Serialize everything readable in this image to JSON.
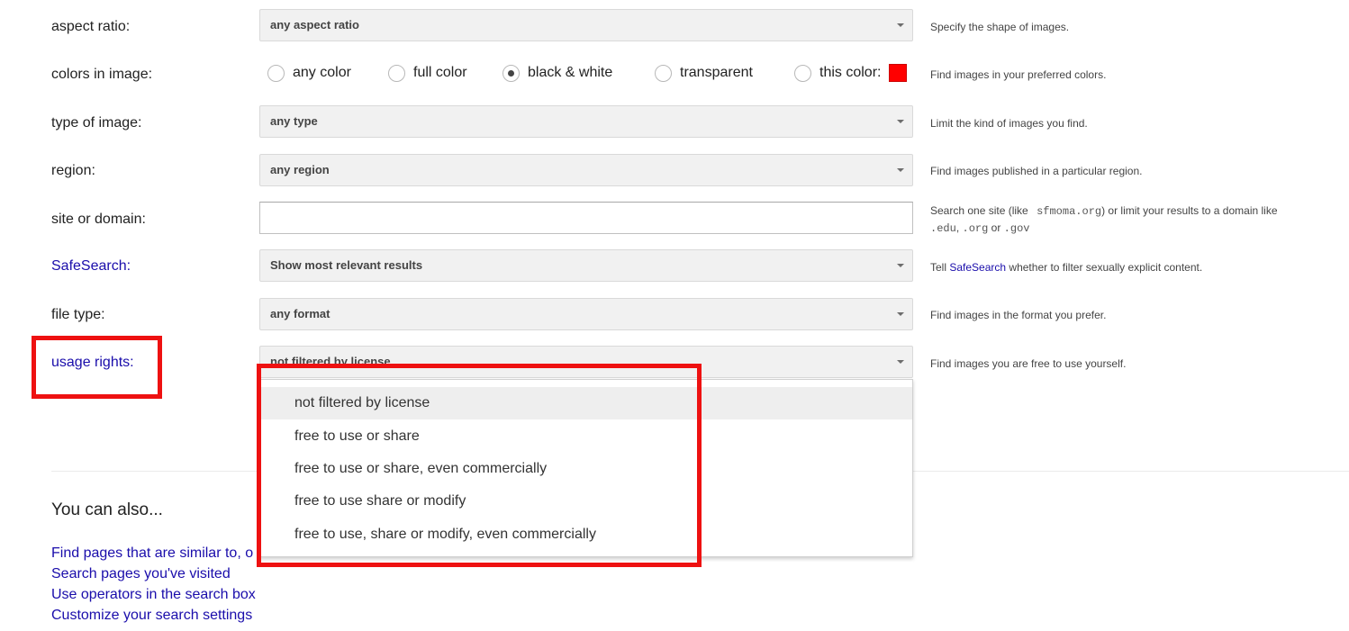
{
  "rows": {
    "aspect_ratio": {
      "label": "aspect ratio:",
      "value": "any aspect ratio",
      "hint": "Specify the shape of images."
    },
    "colors": {
      "label": "colors in image:",
      "options": [
        "any color",
        "full color",
        "black & white",
        "transparent",
        "this color:"
      ],
      "selected": "black & white",
      "swatch_color": "#ff0000",
      "hint": "Find images in your preferred colors."
    },
    "type": {
      "label": "type of image:",
      "value": "any type",
      "hint": "Limit the kind of images you find."
    },
    "region": {
      "label": "region:",
      "value": "any region",
      "hint": "Find images published in a particular region."
    },
    "site": {
      "label": "site or domain:",
      "value": "",
      "hint_prefix": "Search one site (like",
      "hint_example": "sfmoma.org",
      "hint_middle": ") or limit your results to a domain like",
      "hint_edu": ".edu",
      "hint_sep1": ",",
      "hint_org": ".org",
      "hint_or": "or",
      "hint_gov": ".gov"
    },
    "safesearch": {
      "label": "SafeSearch:",
      "value": "Show most relevant results",
      "hint_prefix": "Tell",
      "hint_link": "SafeSearch",
      "hint_suffix": "whether to filter sexually explicit content."
    },
    "file_type": {
      "label": "file type:",
      "value": "any format",
      "hint": "Find images in the format you prefer."
    },
    "usage_rights": {
      "label": "usage rights:",
      "value": "not filtered by license",
      "hint": "Find images you are free to use yourself.",
      "options": [
        "not filtered by license",
        "free to use or share",
        "free to use or share, even commercially",
        "free to use share or modify",
        "free to use, share or modify, even commercially"
      ]
    }
  },
  "also": {
    "title": "You can also...",
    "links": [
      "Find pages that are similar to, o",
      "Search pages you've visited",
      "Use operators in the search box",
      "Customize your search settings"
    ]
  },
  "colors": {
    "link": "#1a0dab",
    "highlight": "#ee1111"
  }
}
